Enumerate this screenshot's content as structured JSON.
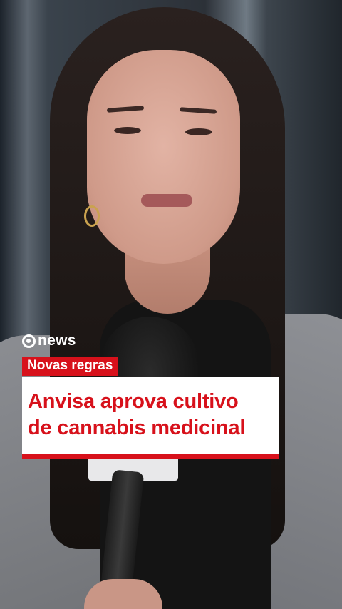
{
  "overlay": {
    "brand": {
      "text": "news",
      "icon": "globo-circle-logo"
    },
    "tag": "Novas regras",
    "headline": {
      "line1": "Anvisa aprova cultivo",
      "line2": "de cannabis medicinal"
    }
  },
  "colors": {
    "accent_red": "#d7111b",
    "headline_bg": "#ffffff",
    "brand_text": "#ffffff"
  }
}
